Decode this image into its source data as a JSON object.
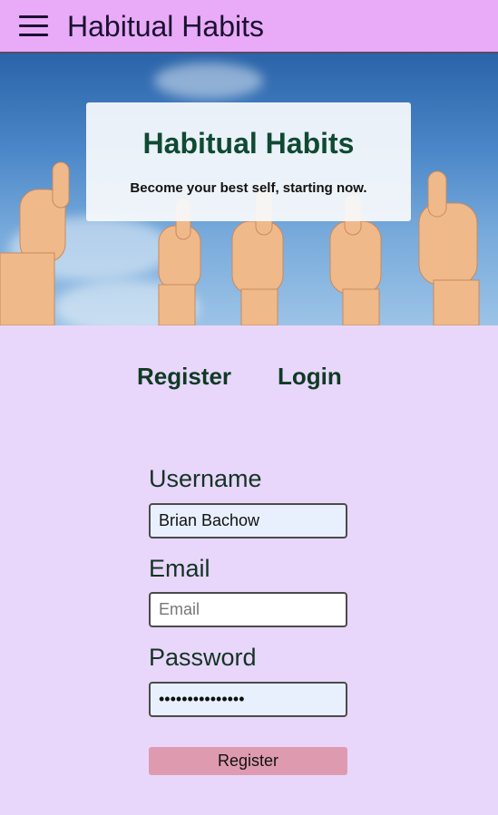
{
  "header": {
    "title": "Habitual Habits"
  },
  "hero": {
    "title": "Habitual Habits",
    "subtitle": "Become your best self, starting now."
  },
  "tabs": [
    {
      "label": "Register"
    },
    {
      "label": "Login"
    }
  ],
  "form": {
    "username": {
      "label": "Username",
      "value": "Brian Bachow"
    },
    "email": {
      "label": "Email",
      "value": "",
      "placeholder": "Email"
    },
    "password": {
      "label": "Password",
      "value": "•••••••••••••••"
    },
    "submit_label": "Register"
  },
  "colors": {
    "header_bg": "#e9abf8",
    "page_bg": "#e8d7fb",
    "title_green": "#0f4a33",
    "button_pink": "#de9bb0"
  }
}
